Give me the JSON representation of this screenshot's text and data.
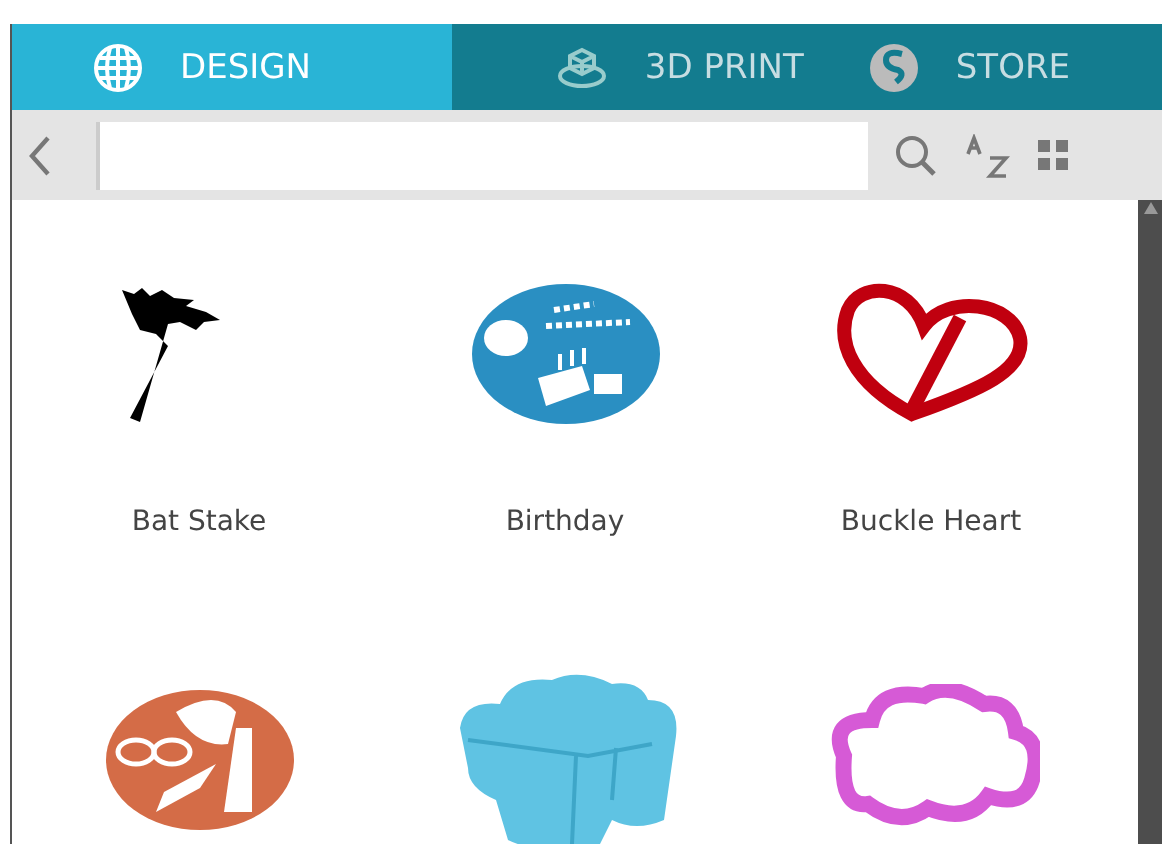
{
  "tabs": [
    {
      "label": "DESIGN",
      "selected": true
    },
    {
      "label": "3D PRINT",
      "selected": false
    },
    {
      "label": "STORE",
      "selected": false
    }
  ],
  "projects": [
    {
      "label": "Bat Stake"
    },
    {
      "label": "Birthday"
    },
    {
      "label": "Buckle Heart"
    }
  ]
}
